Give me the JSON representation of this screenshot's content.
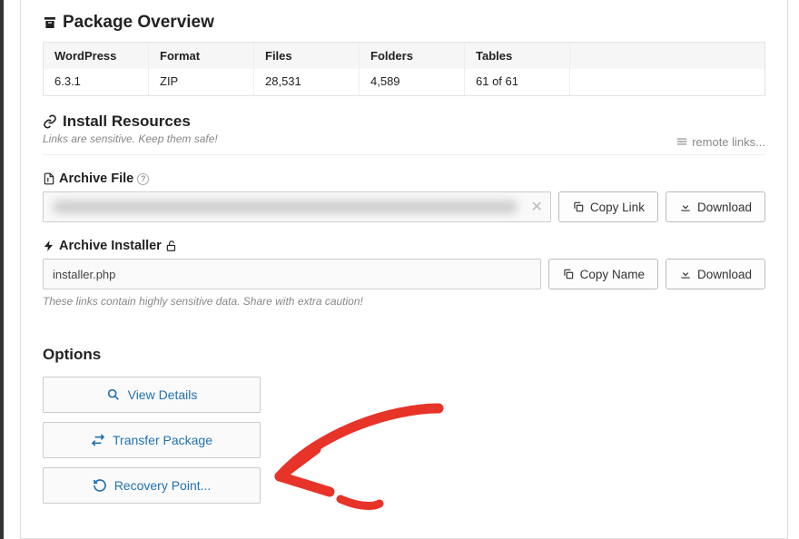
{
  "header": {
    "title": "Package Overview"
  },
  "overview": {
    "cols": [
      {
        "label": "WordPress",
        "value": "6.3.1"
      },
      {
        "label": "Format",
        "value": "ZIP"
      },
      {
        "label": "Files",
        "value": "28,531"
      },
      {
        "label": "Folders",
        "value": "4,589"
      },
      {
        "label": "Tables",
        "value": "61 of 61"
      }
    ]
  },
  "resources": {
    "title": "Install Resources",
    "subtext": "Links are sensitive. Keep them safe!",
    "remote_label": "remote links...",
    "archive_file": {
      "label": "Archive File",
      "value": "",
      "copy_btn": "Copy Link",
      "download_btn": "Download"
    },
    "archive_installer": {
      "label": "Archive Installer",
      "value": "installer.php",
      "copy_btn": "Copy Name",
      "download_btn": "Download"
    },
    "caution": "These links contain highly sensitive data. Share with extra caution!"
  },
  "options": {
    "title": "Options",
    "view_details": "View Details",
    "transfer_package": "Transfer Package",
    "recovery_point": "Recovery Point..."
  }
}
